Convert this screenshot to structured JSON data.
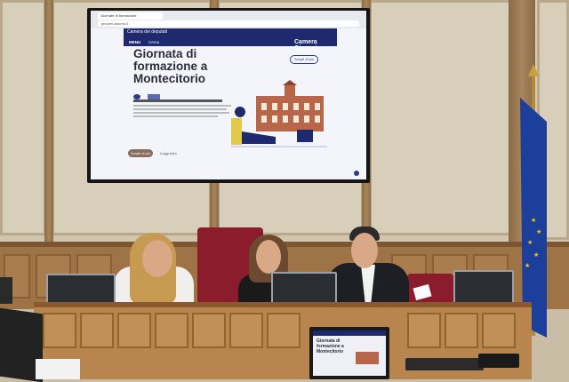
{
  "screen": {
    "tab_title": "Giornate di formazione",
    "url": "giovani.camera.it",
    "site_logo": "Camera dei deputati",
    "menu_label": "MENU",
    "search_label": "Cerca",
    "brand": "Camera Giovani",
    "hero_title": "Giornata di formazione a Montecitorio",
    "pill_button": "Scopri di più",
    "go_button": "Scopri di più",
    "link": "Leggi tutto"
  },
  "monitor": {
    "title": "Giornata di formazione a Montecitorio"
  },
  "colors": {
    "site_header": "#1f2a6e",
    "chair": "#8b1c2b",
    "wood": "#b8854f",
    "flag": "#1c3f9c"
  }
}
